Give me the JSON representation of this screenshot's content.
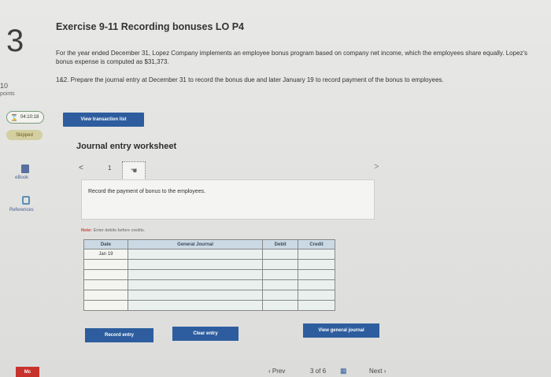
{
  "question": {
    "number": "3",
    "points_value": "10",
    "points_label": "points"
  },
  "timer": {
    "text": "04:10:18"
  },
  "status_badge": "Skipped",
  "sidebar": {
    "ebook_label": "eBook",
    "references_label": "References"
  },
  "brand": {
    "logo_text": "Mc"
  },
  "exercise": {
    "title": "Exercise 9-11 Recording bonuses LO P4",
    "paragraph1": "For the year ended December 31, Lopez Company implements an employee bonus program based on company net income, which the employees share equally. Lopez's bonus expense is computed as $31,373.",
    "paragraph2": "1&2. Prepare the journal entry at December 31 to record the bonus due and later January 19 to record payment of the bonus to employees."
  },
  "buttons": {
    "view_transaction_list": "View transaction list",
    "record_entry": "Record entry",
    "clear_entry": "Clear entry",
    "view_general_journal": "View general journal"
  },
  "worksheet": {
    "title": "Journal entry worksheet",
    "step_number": "1",
    "instruction": "Record the payment of bonus to the employees.",
    "note_prefix": "Note:",
    "note_text": " Enter debits before credits."
  },
  "journal_table": {
    "headers": [
      "Date",
      "General Journal",
      "Debit",
      "Credit"
    ],
    "rows": [
      {
        "date": "Jan 19",
        "account": "",
        "debit": "",
        "credit": ""
      },
      {
        "date": "",
        "account": "",
        "debit": "",
        "credit": ""
      },
      {
        "date": "",
        "account": "",
        "debit": "",
        "credit": ""
      },
      {
        "date": "",
        "account": "",
        "debit": "",
        "credit": ""
      },
      {
        "date": "",
        "account": "",
        "debit": "",
        "credit": ""
      },
      {
        "date": "",
        "account": "",
        "debit": "",
        "credit": ""
      }
    ]
  },
  "pagination": {
    "prev_label": "Prev",
    "page_indicator": "3 of 6",
    "next_label": "Next"
  },
  "colors": {
    "button_blue": "#2d5d9e",
    "header_fill": "#cbd9e4",
    "skipped_badge": "#d4cfa1",
    "logo_red": "#c8322d"
  }
}
